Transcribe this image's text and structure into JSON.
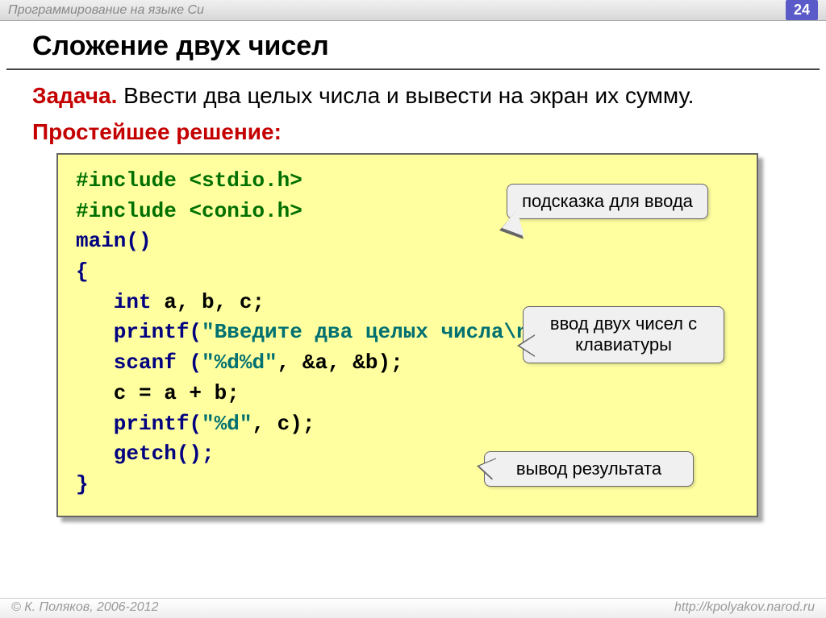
{
  "header": {
    "subject": "Программирование на языке Си",
    "page": "24"
  },
  "title": "Сложение двух чисел",
  "task": {
    "label": "Задача.",
    "text": " Ввести два целых числа и вывести на экран их сумму."
  },
  "solution_label": "Простейшее решение:",
  "code": {
    "l1a": "#include ",
    "l1b": "<stdio.h>",
    "l2a": "#include ",
    "l2b": "<conio.h>",
    "l3": "main()",
    "l4": "{",
    "l5a": "   int",
    "l5b": " a, b, c;",
    "l6a": "   printf(",
    "l6b": "\"Введите два целых числа\\n\"",
    "l6c": ");",
    "l7a": "   scanf (",
    "l7b": "\"%d%d\"",
    "l7c": ", &a, &b);",
    "l8": "   c = a + b;",
    "l9a": "   printf(",
    "l9b": "\"%d\"",
    "l9c": ", c);",
    "l10": "   getch();",
    "l11": "}"
  },
  "callouts": {
    "c1": "подсказка для ввода",
    "c2": "ввод двух чисел с клавиатуры",
    "c3": "вывод результата"
  },
  "footer": {
    "left": "© К. Поляков, 2006-2012",
    "right": "http://kpolyakov.narod.ru"
  }
}
